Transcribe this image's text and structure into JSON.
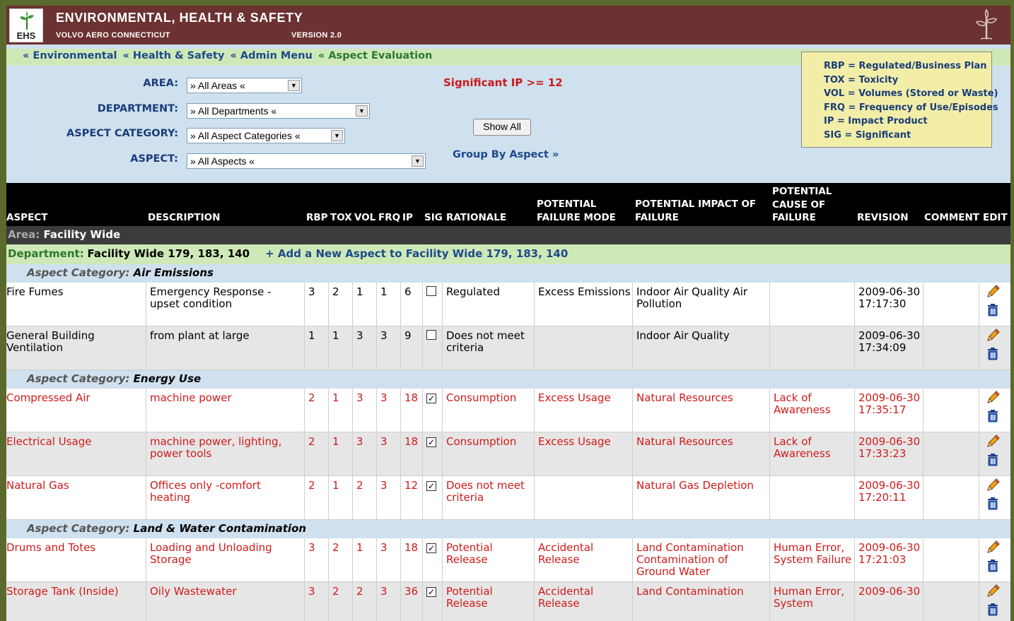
{
  "header": {
    "app_title": "ENVIRONMENTAL, HEALTH & SAFETY",
    "logo_text": "EHS",
    "company": "VOLVO AERO CONNECTICUT",
    "version": "VERSION 2.0",
    "header_color": "#6c3131"
  },
  "breadcrumb": [
    "« Environmental",
    "« Health & Safety",
    "« Admin Menu",
    "« Aspect Evaluation"
  ],
  "filters": {
    "area": {
      "label": "AREA:",
      "value": "» All Areas «"
    },
    "department": {
      "label": "DEPARTMENT:",
      "value": "» All Departments «"
    },
    "aspect_category": {
      "label": "ASPECT CATEGORY:",
      "value": "» All Aspect Categories «"
    },
    "aspect": {
      "label": "ASPECT:",
      "value": "» All Aspects «"
    },
    "significant_note": "Significant IP >= 12",
    "show_all_label": "Show All",
    "group_by_label": "Group By Aspect »"
  },
  "legend": [
    "RBP = Regulated/Business Plan",
    "TOX = Toxicity",
    "VOL = Volumes (Stored or Waste)",
    "FRQ = Frequency of Use/Episodes",
    "IP = Impact Product",
    "SIG = Significant"
  ],
  "table": {
    "headers": {
      "aspect": "ASPECT",
      "description": "DESCRIPTION",
      "rbp": "RBP",
      "tox": "TOX",
      "vol": "VOL",
      "frq": "FRQ",
      "ip": "IP",
      "sig": "SIG",
      "rationale": "RATIONALE",
      "failure_mode_1": "POTENTIAL",
      "failure_mode_2": "FAILURE MODE",
      "impact_1": "POTENTIAL IMPACT OF",
      "impact_2": "FAILURE",
      "cause_1": "POTENTIAL",
      "cause_2": "CAUSE OF",
      "cause_3": "FAILURE",
      "revision": "REVISION",
      "comment": "COMMENT",
      "edit": "EDIT"
    },
    "area": {
      "label": "Area:",
      "value": "Facility Wide"
    },
    "department": {
      "label": "Department:",
      "value": "Facility Wide 179, 183, 140",
      "add_link": "+ Add a New Aspect to Facility Wide 179, 183, 140"
    },
    "category_label": "Aspect Category:",
    "categories": [
      {
        "name": "Air Emissions",
        "rows": [
          {
            "aspect": "Fire Fumes",
            "description": "Emergency Response - upset condition",
            "rbp": "3",
            "tox": "2",
            "vol": "1",
            "frq": "1",
            "ip": "6",
            "sig": false,
            "rationale": "Regulated",
            "failure_mode": "Excess Emissions",
            "impact": "Indoor Air Quality Air Pollution",
            "cause": "",
            "revision": "2009-06-30 17:17:30",
            "comment": ""
          },
          {
            "aspect": "General Building Ventilation",
            "description": "from plant at large",
            "rbp": "1",
            "tox": "1",
            "vol": "3",
            "frq": "3",
            "ip": "9",
            "sig": false,
            "rationale": "Does not meet criteria",
            "failure_mode": "",
            "impact": "Indoor Air Quality",
            "cause": "",
            "revision": "2009-06-30 17:34:09",
            "comment": ""
          }
        ]
      },
      {
        "name": "Energy Use",
        "rows": [
          {
            "aspect": "Compressed Air",
            "description": "machine power",
            "rbp": "2",
            "tox": "1",
            "vol": "3",
            "frq": "3",
            "ip": "18",
            "sig": true,
            "rationale": "Consumption",
            "failure_mode": "Excess Usage",
            "impact": "Natural Resources",
            "cause": "Lack of Awareness",
            "revision": "2009-06-30 17:35:17",
            "comment": ""
          },
          {
            "aspect": "Electrical Usage",
            "description": "machine power, lighting, power tools",
            "rbp": "2",
            "tox": "1",
            "vol": "3",
            "frq": "3",
            "ip": "18",
            "sig": true,
            "rationale": "Consumption",
            "failure_mode": "Excess Usage",
            "impact": "Natural Resources",
            "cause": "Lack of Awareness",
            "revision": "2009-06-30 17:33:23",
            "comment": ""
          },
          {
            "aspect": "Natural Gas",
            "description": "Offices only -comfort heating",
            "rbp": "2",
            "tox": "1",
            "vol": "2",
            "frq": "3",
            "ip": "12",
            "sig": true,
            "rationale": "Does not meet criteria",
            "failure_mode": "",
            "impact": "Natural Gas Depletion",
            "cause": "",
            "revision": "2009-06-30 17:20:11",
            "comment": ""
          }
        ]
      },
      {
        "name": "Land & Water Contamination",
        "rows": [
          {
            "aspect": "Drums and Totes",
            "description": "Loading and Unloading Storage",
            "rbp": "3",
            "tox": "2",
            "vol": "1",
            "frq": "3",
            "ip": "18",
            "sig": true,
            "rationale": "Potential Release",
            "failure_mode": "Accidental Release",
            "impact": "Land Contamination Contamination of Ground Water",
            "cause": "Human Error, System Failure",
            "revision": "2009-06-30 17:21:03",
            "comment": ""
          },
          {
            "aspect": "Storage Tank (Inside)",
            "description": "Oily Wastewater",
            "rbp": "3",
            "tox": "2",
            "vol": "2",
            "frq": "3",
            "ip": "36",
            "sig": true,
            "rationale": "Potential Release",
            "failure_mode": "Accidental Release",
            "impact": "Land Contamination",
            "cause": "Human Error, System",
            "revision": "2009-06-30",
            "comment": ""
          }
        ]
      }
    ],
    "colors": {
      "significant_text": "#d01a1a",
      "normal_text": "#000000"
    }
  }
}
